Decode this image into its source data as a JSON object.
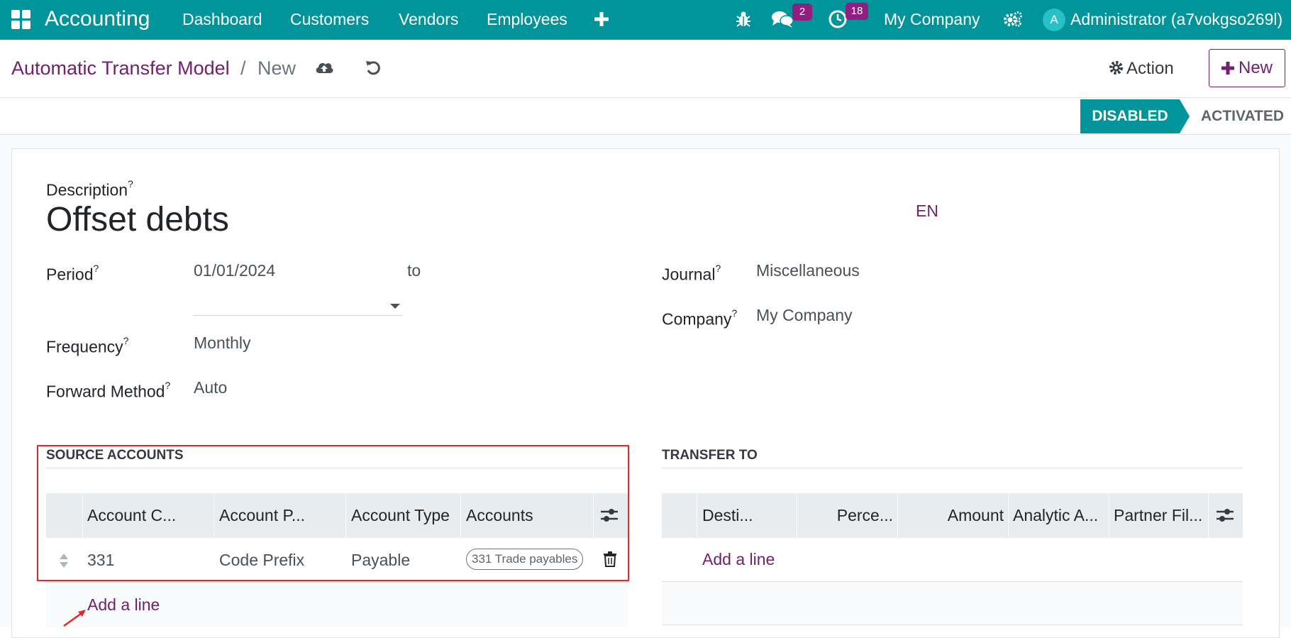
{
  "navbar": {
    "app_name": "Accounting",
    "menu": [
      "Dashboard",
      "Customers",
      "Vendors",
      "Employees"
    ],
    "messages_count": "2",
    "activities_count": "18",
    "company": "My Company",
    "avatar_initial": "A",
    "user": "Administrator (a7vokgso269l)",
    "colors": {
      "bar": "#01949a",
      "badge": "#8f1d82"
    }
  },
  "control_panel": {
    "breadcrumb_parent": "Automatic Transfer Model",
    "breadcrumb_sep": "/",
    "breadcrumb_current": "New",
    "action_label": "Action",
    "new_label": "New"
  },
  "statusbar": {
    "stages": [
      "DISABLED",
      "ACTIVATED"
    ],
    "active": "DISABLED"
  },
  "form": {
    "description_label": "Description",
    "description_value": "Offset debts",
    "lang": "EN",
    "period_label": "Period",
    "period_start": "01/01/2024",
    "period_to": "to",
    "frequency_label": "Frequency",
    "frequency_value": "Monthly",
    "forward_label": "Forward Method",
    "forward_value": "Auto",
    "journal_label": "Journal",
    "journal_value": "Miscellaneous",
    "company_label": "Company",
    "company_value": "My Company",
    "help_mark": "?"
  },
  "source_accounts": {
    "title": "SOURCE ACCOUNTS",
    "columns": [
      "Account C...",
      "Account P...",
      "Account Type",
      "Accounts"
    ],
    "rows": [
      {
        "code": "331",
        "prefix": "Code Prefix",
        "type": "Payable",
        "accounts": "331 Trade payables"
      }
    ],
    "add_line": "Add a line"
  },
  "transfer_to": {
    "title": "TRANSFER TO",
    "columns": [
      "Desti...",
      "Perce...",
      "Amount",
      "Analytic A...",
      "Partner Fil..."
    ],
    "add_line": "Add a line"
  }
}
